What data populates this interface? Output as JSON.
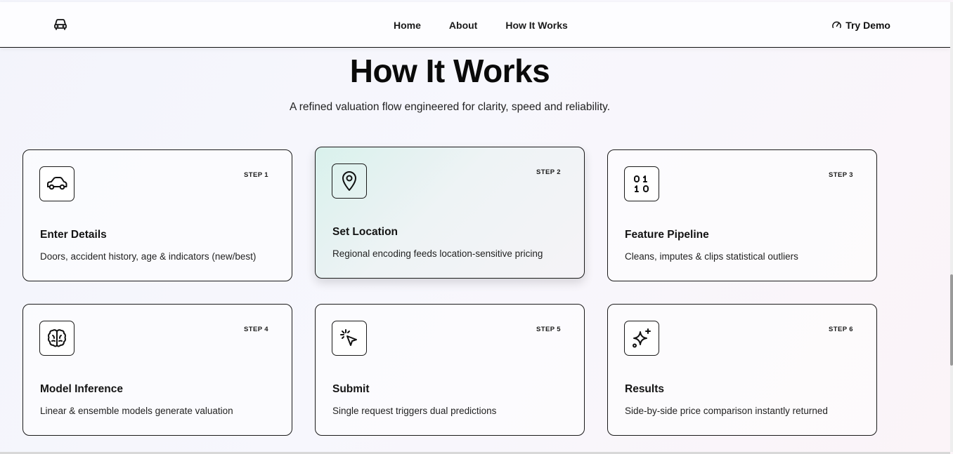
{
  "nav": {
    "logo_icon": "car-icon",
    "links": [
      "Home",
      "About",
      "How It Works"
    ],
    "demo_icon": "speedometer-icon",
    "demo_label": "Try Demo"
  },
  "hero": {
    "title": "How It Works",
    "subtitle": "A refined valuation flow engineered for clarity, speed and reliability."
  },
  "steps": [
    {
      "step": "STEP 1",
      "title": "Enter Details",
      "desc": "Doors, accident history, age & indicators (new/best)",
      "icon": "car-icon"
    },
    {
      "step": "STEP 2",
      "title": "Set Location",
      "desc": "Regional encoding feeds location-sensitive pricing",
      "icon": "map-pin-icon"
    },
    {
      "step": "STEP 3",
      "title": "Feature Pipeline",
      "desc": "Cleans, imputes & clips statistical outliers",
      "icon": "binary-icon"
    },
    {
      "step": "STEP 4",
      "title": "Model Inference",
      "desc": "Linear & ensemble models generate valuation",
      "icon": "brain-icon"
    },
    {
      "step": "STEP 5",
      "title": "Submit",
      "desc": "Single request triggers dual predictions",
      "icon": "cursor-click-icon"
    },
    {
      "step": "STEP 6",
      "title": "Results",
      "desc": "Side-by-side price comparison instantly returned",
      "icon": "sparkles-icon"
    }
  ],
  "colors": {
    "border": "#1a1a1a",
    "highlight": "#d9f1ec"
  }
}
